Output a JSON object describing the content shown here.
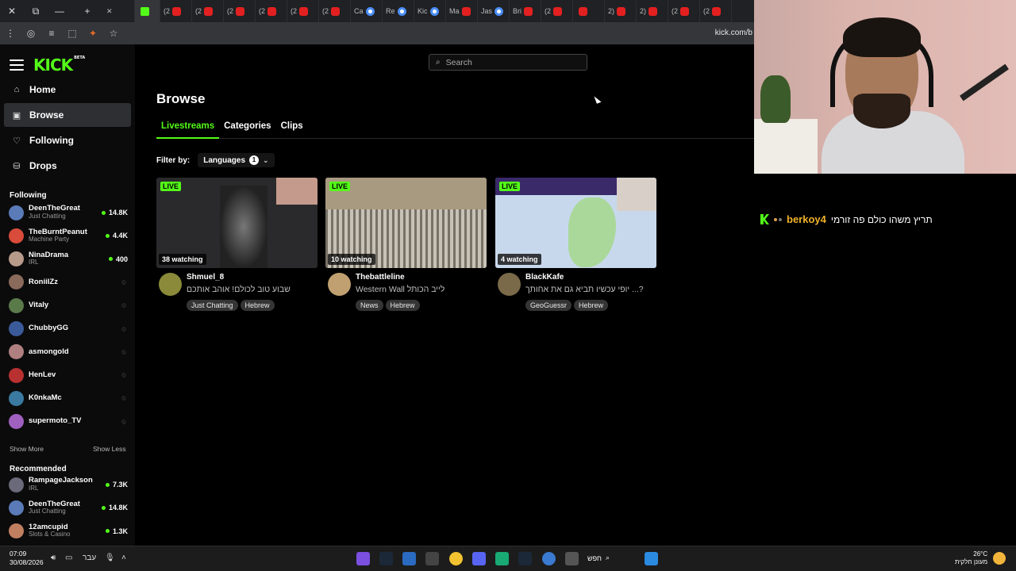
{
  "browser": {
    "tabs": [
      {
        "label": "",
        "favicon": "close",
        "active": false
      },
      {
        "label": "",
        "favicon": "kick",
        "active": true
      },
      {
        "label": "(2",
        "favicon": "youtube"
      },
      {
        "label": "(2",
        "favicon": "youtube"
      },
      {
        "label": "(2",
        "favicon": "youtube"
      },
      {
        "label": "(2",
        "favicon": "youtube"
      },
      {
        "label": "(2",
        "favicon": "youtube"
      },
      {
        "label": "(2",
        "favicon": "youtube"
      },
      {
        "label": "Ca",
        "favicon": "google"
      },
      {
        "label": "Re",
        "favicon": "google"
      },
      {
        "label": "Kic",
        "favicon": "google"
      },
      {
        "label": "Ma",
        "favicon": "youtube"
      },
      {
        "label": "Jas",
        "favicon": "google"
      },
      {
        "label": "Bri",
        "favicon": "youtube"
      },
      {
        "label": "(2",
        "favicon": "youtube"
      },
      {
        "label": "",
        "favicon": "youtube"
      },
      {
        "label": "2)",
        "favicon": "youtube"
      },
      {
        "label": "2)",
        "favicon": "youtube"
      },
      {
        "label": "(2",
        "favicon": "youtube"
      },
      {
        "label": "(2",
        "favicon": "youtube"
      }
    ],
    "url": "kick.com/b"
  },
  "sidebar": {
    "nav": [
      {
        "label": "Home",
        "icon": "home-icon"
      },
      {
        "label": "Browse",
        "icon": "browse-icon"
      },
      {
        "label": "Following",
        "icon": "heart-icon"
      },
      {
        "label": "Drops",
        "icon": "gift-icon"
      }
    ],
    "following_title": "Following",
    "following": [
      {
        "name": "DeenTheGreat",
        "category": "Just Chatting",
        "viewers": "14.8K",
        "live": true,
        "color": "#5a7bb8"
      },
      {
        "name": "TheBurntPeanut",
        "category": "Machine Party",
        "viewers": "4.4K",
        "live": true,
        "color": "#d94b3a"
      },
      {
        "name": "NinaDrama",
        "category": "IRL",
        "viewers": "400",
        "live": true,
        "color": "#b89a8a"
      },
      {
        "name": "RoniiIZz",
        "category": "",
        "viewers": "",
        "live": false,
        "color": "#8a6a5a"
      },
      {
        "name": "Vitaly",
        "category": "",
        "viewers": "",
        "live": false,
        "color": "#5a7a4a"
      },
      {
        "name": "ChubbyGG",
        "category": "",
        "viewers": "",
        "live": false,
        "color": "#3a5a9a"
      },
      {
        "name": "asmongold",
        "category": "",
        "viewers": "",
        "live": false,
        "color": "#b08080"
      },
      {
        "name": "HenLev",
        "category": "",
        "viewers": "",
        "live": false,
        "color": "#b83030"
      },
      {
        "name": "K0nkaMc",
        "category": "",
        "viewers": "",
        "live": false,
        "color": "#3a7aa0"
      },
      {
        "name": "supermoto_TV",
        "category": "",
        "viewers": "",
        "live": false,
        "color": "#a060c0"
      }
    ],
    "show_more": "Show More",
    "show_less": "Show Less",
    "recommended_title": "Recommended",
    "recommended": [
      {
        "name": "RampageJackson",
        "category": "IRL",
        "viewers": "7.3K",
        "live": true,
        "color": "#6a6a7a"
      },
      {
        "name": "DeenTheGreat",
        "category": "Just Chatting",
        "viewers": "14.8K",
        "live": true,
        "color": "#5a7bb8"
      },
      {
        "name": "12amcupid",
        "category": "Slots & Casino",
        "viewers": "1.3K",
        "live": true,
        "color": "#c08060"
      }
    ]
  },
  "main": {
    "search_placeholder": "Search",
    "title": "Browse",
    "tabs": [
      "Livestreams",
      "Categories",
      "Clips"
    ],
    "filter_label": "Filter by:",
    "language_button": "Languages",
    "language_count": "1",
    "cards": [
      {
        "live_label": "LIVE",
        "watching": "38 watching",
        "channel": "Shmuel_8",
        "title": "שבוע טוב לכולם! אוהב אותכם",
        "tags": [
          "Just Chatting",
          "Hebrew"
        ],
        "thumb": "#2a2a2c",
        "avatar": "#8a8a3a"
      },
      {
        "live_label": "LIVE",
        "watching": "10 watching",
        "channel": "Thebattleline",
        "title": "לייב הכותל Western Wall",
        "tags": [
          "News",
          "Hebrew"
        ],
        "thumb": "#b8aa90",
        "avatar": "#c0a070"
      },
      {
        "live_label": "LIVE",
        "watching": "4 watching",
        "channel": "BlackKafe",
        "title": "?... יופי עכשיו תביא גם את אחותך",
        "tags": [
          "GeoGuessr",
          "Hebrew"
        ],
        "thumb": "#c8d8ec",
        "avatar": "#7a6a4a"
      }
    ]
  },
  "overlay": {
    "chat_user": "berkoy4",
    "chat_message": "תריץ משהו כולם פה זורמי"
  },
  "taskbar": {
    "time": "07:09",
    "date": "30/08/2026",
    "lang": "עבר",
    "search_label": "חפש",
    "temperature": "26°C",
    "weather_text": "מעונן חלקית"
  }
}
